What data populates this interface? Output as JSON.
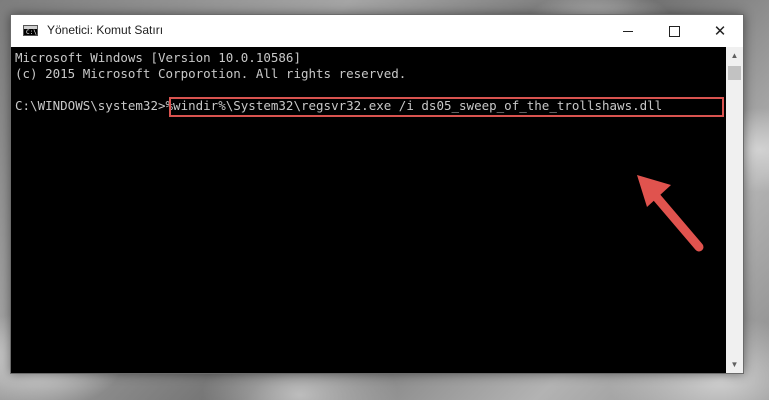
{
  "window": {
    "title": "Yönetici: Komut Satırı",
    "icon": "console-icon"
  },
  "console": {
    "line1": "Microsoft Windows [Version 10.0.10586]",
    "line2": "(c) 2015 Microsoft Corporotion. All rights reserved.",
    "prompt": "C:\\WINDOWS\\system32>",
    "command": "%windir%\\System32\\regsvr32.exe /i ds05_sweep_of_the_trollshaws.dll"
  },
  "colors": {
    "highlight": "#d9534f",
    "arrow": "#e0534e"
  }
}
